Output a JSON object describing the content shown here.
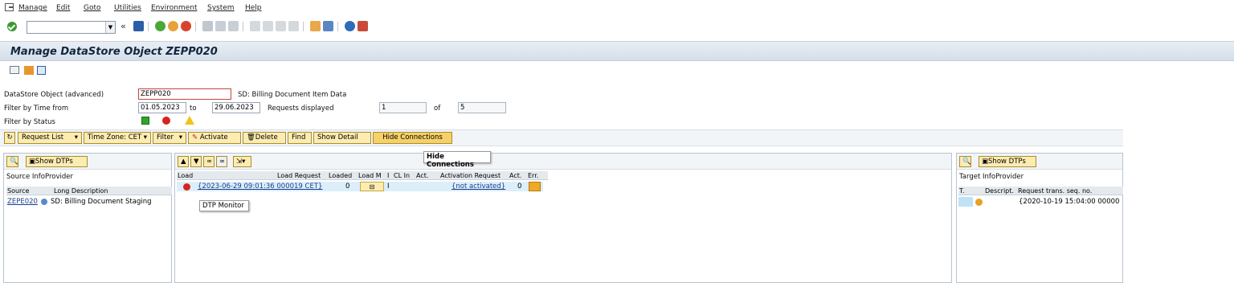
{
  "menu": [
    "Manage",
    "Edit",
    "Goto",
    "Utilities",
    "Environment",
    "System",
    "Help"
  ],
  "toolbar": {
    "cmd_value": ""
  },
  "title": "Manage DataStore Object ZEPP020",
  "form": {
    "dso_label": "DataStore Object (advanced)",
    "dso_value": "ZEPP020",
    "dso_desc": "SD: Billing Document Item Data",
    "filter_time_label": "Filter by Time from",
    "from_date": "01.05.2023",
    "to_label": "to",
    "to_date": "29.06.2023",
    "requests_displayed_label": "Requests displayed",
    "requests_displayed": "1",
    "of_label": "of",
    "requests_total": "5",
    "filter_status_label": "Filter by Status"
  },
  "actions": {
    "request_list": "Request List",
    "time_zone": "Time Zone: CET",
    "filter": "Filter",
    "activate": "Activate",
    "delete": "Delete",
    "find": "Find",
    "show_detail": "Show Detail",
    "hide_connections": "Hide Connections"
  },
  "tooltips": {
    "hide_connections": "Hide Connections",
    "dtp_monitor": "DTP Monitor"
  },
  "left_panel": {
    "show_dtps": "Show DTPs",
    "title": "Source InfoProvider",
    "headers": [
      "Source",
      "Long Description"
    ],
    "rows": [
      {
        "source": "ZEPE020",
        "desc": "SD: Billing Document Staging"
      }
    ]
  },
  "center_panel": {
    "headers": [
      "Load",
      "Load Request",
      "Loaded",
      "Load M",
      "I",
      "CL In",
      "Act.",
      "Activation Request",
      "Act.",
      "Err."
    ],
    "row": {
      "load_request": "{2023-06-29 09:01:36 000019 CET}",
      "loaded": "0",
      "i": "I",
      "activation_request": "{not activated}",
      "act": "0"
    }
  },
  "right_panel": {
    "show_dtps": "Show DTPs",
    "title": "Target InfoProvider",
    "headers": [
      "T.",
      "Descript.",
      "Request trans. seq. no."
    ],
    "row": {
      "request": "{2020-10-19 15:04:00 00000"
    }
  },
  "colors": {
    "accent": "#fcecb2",
    "title_bg": "#d5dfe9",
    "link": "#1a3e8c"
  }
}
